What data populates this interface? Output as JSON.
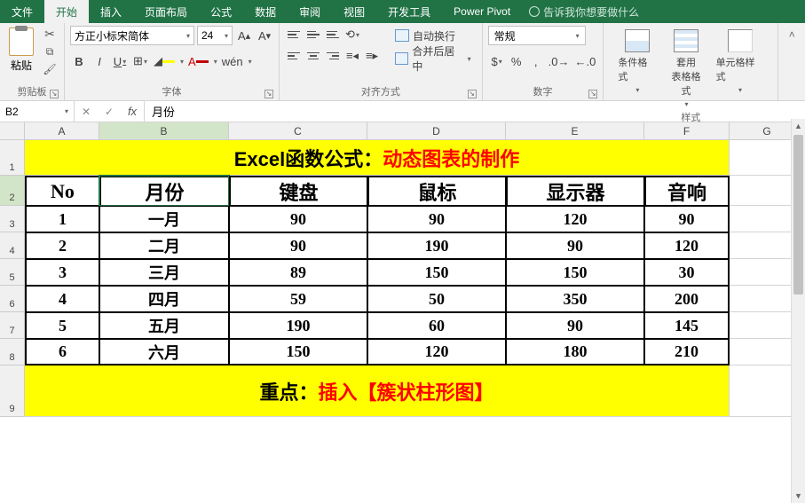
{
  "tabs": {
    "file": "文件",
    "home": "开始",
    "insert": "插入",
    "layout": "页面布局",
    "formulas": "公式",
    "data": "数据",
    "review": "审阅",
    "view": "视图",
    "dev": "开发工具",
    "pivot": "Power Pivot",
    "tellme": "告诉我你想要做什么"
  },
  "ribbon": {
    "clipboard": {
      "paste": "粘贴",
      "group": "剪贴板"
    },
    "font": {
      "name": "方正小标宋简体",
      "size": "24",
      "group": "字体",
      "bold": "B",
      "italic": "I",
      "underline": "U",
      "pinyin": "wén"
    },
    "align": {
      "group": "对齐方式",
      "wrap": "自动换行",
      "merge": "合并后居中"
    },
    "number": {
      "group": "数字",
      "format": "常规"
    },
    "styles": {
      "group": "样式",
      "cond": "条件格式",
      "table": "套用\n表格格式",
      "cell": "单元格样式"
    }
  },
  "namebox": "B2",
  "formula": "月份",
  "cols": [
    "A",
    "B",
    "C",
    "D",
    "E",
    "F",
    "G"
  ],
  "rownums": [
    "1",
    "2",
    "3",
    "4",
    "5",
    "6",
    "7",
    "8",
    "9"
  ],
  "title": {
    "a": "Excel函数公式：",
    "b": "动态图表的制作"
  },
  "headers": [
    "No",
    "月份",
    "键盘",
    "鼠标",
    "显示器",
    "音响"
  ],
  "rows": [
    [
      "1",
      "一月",
      "90",
      "90",
      "120",
      "90"
    ],
    [
      "2",
      "二月",
      "90",
      "190",
      "90",
      "120"
    ],
    [
      "3",
      "三月",
      "89",
      "150",
      "150",
      "30"
    ],
    [
      "4",
      "四月",
      "59",
      "50",
      "350",
      "200"
    ],
    [
      "5",
      "五月",
      "190",
      "60",
      "90",
      "145"
    ],
    [
      "6",
      "六月",
      "150",
      "120",
      "180",
      "210"
    ]
  ],
  "footer": {
    "a": "重点：",
    "b": "插入【簇状柱形图】"
  },
  "chart_data": {
    "type": "table",
    "categories": [
      "一月",
      "二月",
      "三月",
      "四月",
      "五月",
      "六月"
    ],
    "series": [
      {
        "name": "键盘",
        "values": [
          90,
          90,
          89,
          59,
          190,
          150
        ]
      },
      {
        "name": "鼠标",
        "values": [
          90,
          190,
          150,
          50,
          60,
          120
        ]
      },
      {
        "name": "显示器",
        "values": [
          120,
          90,
          150,
          350,
          90,
          180
        ]
      },
      {
        "name": "音响",
        "values": [
          90,
          120,
          30,
          200,
          145,
          210
        ]
      }
    ],
    "title": "动态图表的制作"
  }
}
